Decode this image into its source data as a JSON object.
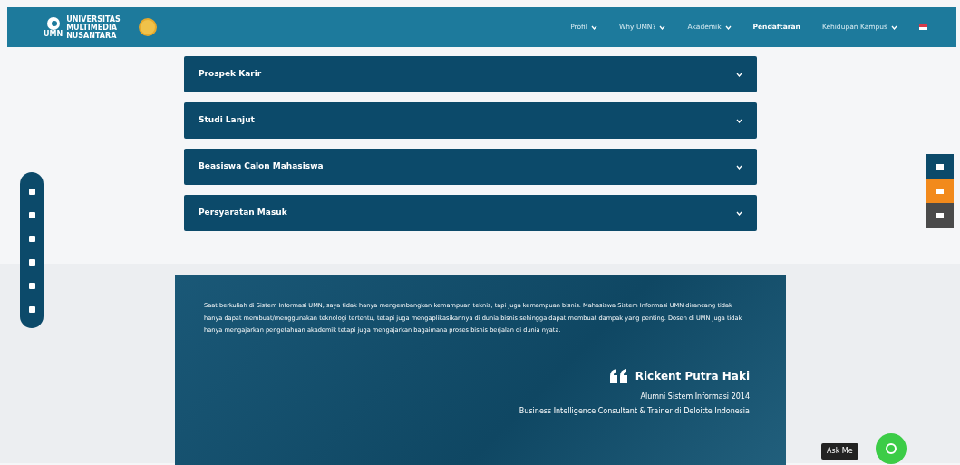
{
  "navbar": {
    "logo_text": [
      "UNIVERSITAS",
      "MULTIMEDIA",
      "NUSANTARA"
    ],
    "logo_abbr": "UMN",
    "menu": [
      {
        "label": "Profil",
        "dropdown": true,
        "selected": false
      },
      {
        "label": "Why UMN?",
        "dropdown": true,
        "selected": false
      },
      {
        "label": "Akademik",
        "dropdown": true,
        "selected": false
      },
      {
        "label": "Pendaftaran",
        "dropdown": false,
        "selected": true
      },
      {
        "label": "Kehidupan Kampus",
        "dropdown": true,
        "selected": false
      }
    ]
  },
  "accordion": [
    {
      "title": "Prospek Karir",
      "expanded": false
    },
    {
      "title": "Studi Lanjut",
      "expanded": false
    },
    {
      "title": "Beasiswa Calon Mahasiswa",
      "expanded": false
    },
    {
      "title": "Persyaratan Masuk",
      "expanded": false
    }
  ],
  "testimonial": {
    "quote": "Saat berkuliah di Sistem Informasi UMN, saya tidak hanya mengembangkan kemampuan teknis, tapi juga kemampuan bisnis. Mahasiswa Sistem Informasi UMN dirancang tidak hanya dapat membuat/menggunakan teknologi tertentu, tetapi juga mengaplikasikannya di dunia bisnis sehingga dapat membuat dampak yang penting. Dosen di UMN juga tidak hanya mengajarkan pengetahuan akademik tetapi juga mengajarkan bagaimana proses bisnis berjalan di dunia nyata.",
    "name": "Rickent Putra Haki",
    "role": "Alumni Sistem Informasi 2014",
    "position": "Business Intelligence Consultant & Trainer di Deloitte Indonesia"
  },
  "chat": {
    "label": "Ask Me"
  }
}
